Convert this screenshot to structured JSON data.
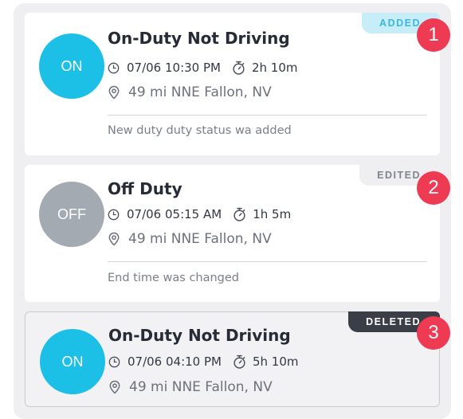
{
  "colors": {
    "on_status": "#1cc0e6",
    "off_status": "#a4aab2",
    "added_tag_bg": "#c7eef8",
    "added_tag_text": "#3ab8dc",
    "edited_tag_bg": "#efeff2",
    "edited_tag_text": "#7f848c",
    "deleted_tag_bg": "#3a3f47",
    "deleted_tag_text": "#ffffff",
    "badge": "#ee3a52"
  },
  "icons": {
    "time": "clock-icon",
    "duration": "stopwatch-icon",
    "location": "location-pin-icon"
  },
  "entries": [
    {
      "avatar_label": "ON",
      "status_title": "On-Duty Not Driving",
      "time": "07/06 10:30 PM",
      "duration": "2h 10m",
      "location": "49 mi NNE Fallon, NV",
      "change_note": "New duty duty status wa added",
      "tag": "ADDED",
      "badge_number": "1"
    },
    {
      "avatar_label": "OFF",
      "status_title": "Off Duty",
      "time": "07/06 05:15 AM",
      "duration": "1h 5m",
      "location": "49 mi NNE Fallon, NV",
      "change_note": "End time was changed",
      "tag": "EDITED",
      "badge_number": "2"
    },
    {
      "avatar_label": "ON",
      "status_title": "On-Duty Not Driving",
      "time": "07/06 04:10 PM",
      "duration": "5h 10m",
      "location": "49 mi NNE Fallon, NV",
      "tag": "DELETED",
      "badge_number": "3"
    }
  ]
}
